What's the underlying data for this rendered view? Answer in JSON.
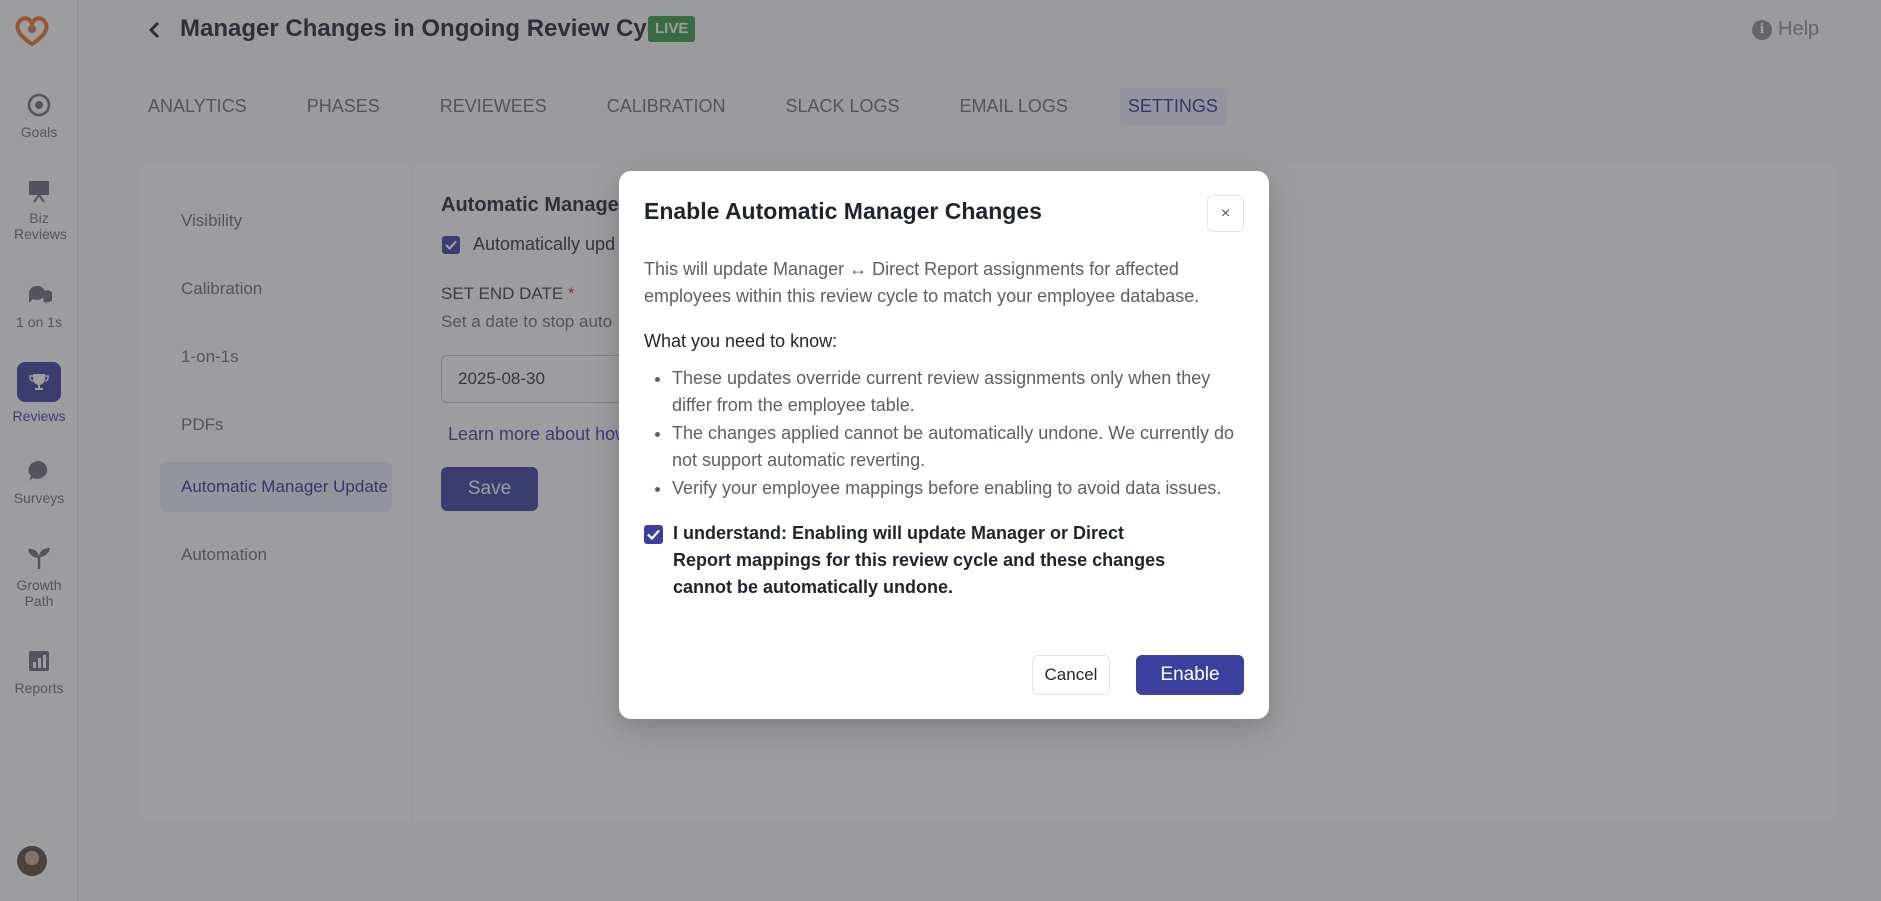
{
  "sidebar": {
    "items": [
      {
        "label": "Goals",
        "icon": "target-icon"
      },
      {
        "label": "Biz Reviews",
        "icon": "presentation-icon"
      },
      {
        "label": "1 on 1s",
        "icon": "chat-icon"
      },
      {
        "label": "Reviews",
        "icon": "trophy-icon"
      },
      {
        "label": "Surveys",
        "icon": "survey-bubble-icon"
      },
      {
        "label": "Growth Path",
        "icon": "sprout-icon"
      },
      {
        "label": "Reports",
        "icon": "report-icon"
      }
    ],
    "active": "Reviews"
  },
  "header": {
    "title": "Manager Changes in Ongoing Review Cycle",
    "badge": "LIVE",
    "help": "Help"
  },
  "tabs": [
    "ANALYTICS",
    "PHASES",
    "REVIEWEES",
    "CALIBRATION",
    "SLACK LOGS",
    "EMAIL LOGS",
    "SETTINGS"
  ],
  "active_tab": "SETTINGS",
  "subnav": {
    "items": [
      "Visibility",
      "Calibration",
      "1-on-1s",
      "PDFs",
      "Automatic Manager Update",
      "Automation"
    ],
    "active": "Automatic Manager Update"
  },
  "settings": {
    "section_title": "Automatic Manage",
    "auto_label": "Automatically upd",
    "end_date_label": "SET END DATE",
    "required_mark": "*",
    "end_date_help": "Set a date to stop auto",
    "end_date_value": "2025-08-30",
    "learn_more": "Learn more about how",
    "save": "Save"
  },
  "modal": {
    "title": "Enable Automatic Manager Changes",
    "close": "×",
    "intro": "This will update Manager ↔ Direct Report assignments for affected employees within this review cycle to match your employee database.",
    "know_heading": "What you need to know:",
    "bullets": [
      "These updates override current review assignments only when they differ from the employee table.",
      "The changes applied cannot be automatically undone. We currently do not support automatic reverting.",
      "Verify your employee mappings before enabling to avoid data issues."
    ],
    "acknowledge": "I understand: Enabling will update Manager or Direct Report mappings for this review cycle and these changes cannot be automatically undone.",
    "cancel": "Cancel",
    "enable": "Enable"
  },
  "colors": {
    "accent": "#3b3f9e",
    "live": "#3a9a45",
    "logo": "#e8742a"
  }
}
